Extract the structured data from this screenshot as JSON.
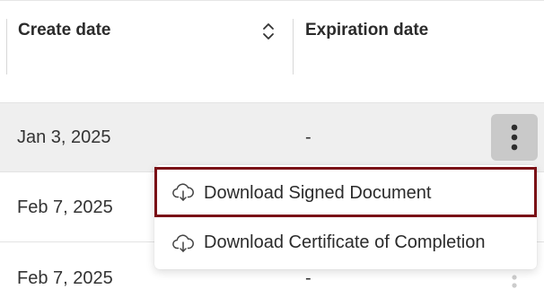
{
  "table": {
    "columns": [
      {
        "label": "Create date"
      },
      {
        "label": "Expiration date"
      }
    ],
    "rows": [
      {
        "create_date": "Jan 3, 2025",
        "expiration_date": "-"
      },
      {
        "create_date": "Feb 7, 2025",
        "expiration_date": "-"
      },
      {
        "create_date": "Feb 7, 2025",
        "expiration_date": "-"
      }
    ]
  },
  "icons": {
    "sort": "sort-icon",
    "row_actions": "more-vertical-icon",
    "menu_item": "cloud-download-icon"
  },
  "menu": {
    "items": [
      {
        "label": "Download Signed Document",
        "icon": "cloud-download-icon"
      },
      {
        "label": "Download Certificate of Completion",
        "icon": "cloud-download-icon"
      }
    ]
  },
  "colors": {
    "highlight_border": "#7a1016",
    "selected_row_bg": "#efefef",
    "kebab_active_bg": "#c9c9c9"
  }
}
